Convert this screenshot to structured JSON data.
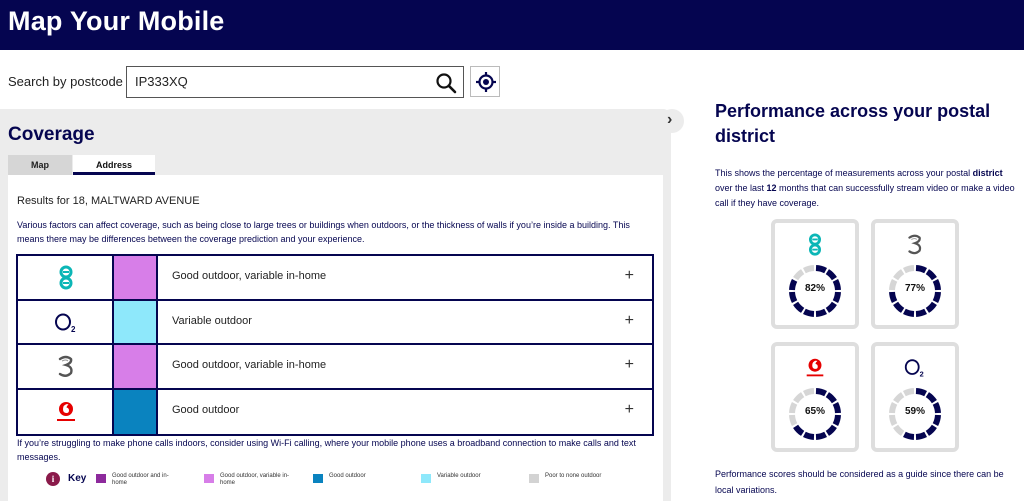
{
  "header": {
    "title": "Map Your Mobile"
  },
  "search": {
    "label": "Search by postcode",
    "value": "IP333XQ"
  },
  "coverage": {
    "title": "Coverage",
    "tabs": [
      {
        "label": "Map"
      },
      {
        "label": "Address"
      }
    ],
    "results_for": "Results for 18, MALTWARD AVENUE",
    "intro": "Various factors can affect coverage, such as being close to large trees or buildings when outdoors, or the thickness of walls if you’re inside a building. This means there may be differences between the coverage prediction and your experience.",
    "operators": [
      {
        "name": "EE",
        "logo": "ee-logo",
        "color": "#d77ee8",
        "status": "Good outdoor, variable in-home"
      },
      {
        "name": "O2",
        "logo": "o2-logo",
        "color": "#8ee8fb",
        "status": "Variable outdoor"
      },
      {
        "name": "Three",
        "logo": "three-logo",
        "color": "#d77ee8",
        "status": "Good outdoor, variable in-home"
      },
      {
        "name": "Vodafone",
        "logo": "vodafone-logo",
        "color": "#0a83bf",
        "status": "Good outdoor"
      }
    ],
    "expand_symbol": "+",
    "struggle_text": "If you’re struggling to make phone calls indoors, consider using Wi-Fi calling, where your mobile phone uses a broadband connection to make calls and text messages.",
    "key": {
      "label": "Key",
      "items": [
        {
          "label": "Good outdoor and in-home",
          "color": "#8d2a9c"
        },
        {
          "label": "Good outdoor, variable in-home",
          "color": "#d77ee8"
        },
        {
          "label": "Good outdoor",
          "color": "#0a83bf"
        },
        {
          "label": "Variable outdoor",
          "color": "#8ee8fb"
        },
        {
          "label": "Poor to none outdoor",
          "color": "#d3d3d3"
        }
      ]
    }
  },
  "performance": {
    "title": "Performance across your postal district",
    "desc_1": "This shows the percentage of measurements across your postal ",
    "desc_bold_1": "district",
    "desc_2": " over the last ",
    "desc_bold_2": "12",
    "desc_3": " months that can successfully stream video or make a video call if they have coverage.",
    "cards": [
      {
        "operator": "EE",
        "logo": "ee-logo",
        "percent": 82,
        "label": "82%"
      },
      {
        "operator": "Three",
        "logo": "three-logo",
        "percent": 77,
        "label": "77%"
      },
      {
        "operator": "Vodafone",
        "logo": "vodafone-logo",
        "percent": 65,
        "label": "65%"
      },
      {
        "operator": "O2",
        "logo": "o2-logo",
        "percent": 59,
        "label": "59%"
      }
    ],
    "note": "Performance scores should be considered as a guide since there can be local variations."
  },
  "colors": {
    "navy": "#050550",
    "panel": "#ececec",
    "ring_track": "#d6d6d6",
    "ring_fill": "#050550"
  }
}
